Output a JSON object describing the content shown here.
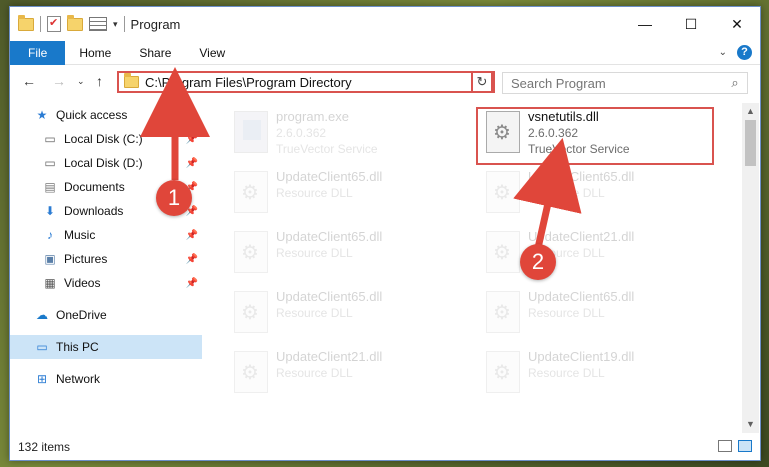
{
  "window": {
    "title": "Program",
    "controls": {
      "minimize": "—",
      "maximize": "☐",
      "close": "✕"
    }
  },
  "ribbon": {
    "tabs": [
      "File",
      "Home",
      "Share",
      "View"
    ],
    "expand_icon": "chevron-down",
    "help": "?"
  },
  "address": {
    "path": "C:\\Program Files\\Program Directory",
    "search_placeholder": "Search Program"
  },
  "sidebar": {
    "items": [
      {
        "label": "Quick access",
        "icon": "star-icon",
        "pinned": false
      },
      {
        "label": "Local Disk (C:)",
        "icon": "drive-icon",
        "pinned": true
      },
      {
        "label": "Local Disk (D:)",
        "icon": "drive-icon",
        "pinned": true
      },
      {
        "label": "Documents",
        "icon": "documents-icon",
        "pinned": true
      },
      {
        "label": "Downloads",
        "icon": "downloads-icon",
        "pinned": true
      },
      {
        "label": "Music",
        "icon": "music-icon",
        "pinned": true
      },
      {
        "label": "Pictures",
        "icon": "pictures-icon",
        "pinned": true
      },
      {
        "label": "Videos",
        "icon": "videos-icon",
        "pinned": true
      },
      {
        "label": "OneDrive",
        "icon": "cloud-icon",
        "pinned": false
      },
      {
        "label": "This PC",
        "icon": "computer-icon",
        "pinned": false,
        "selected": true
      },
      {
        "label": "Network",
        "icon": "network-icon",
        "pinned": false
      }
    ]
  },
  "files": [
    {
      "name": "program.exe",
      "line2": "2.6.0.362",
      "line3": "TrueVector Service",
      "type": "exe",
      "faded": true
    },
    {
      "name": "vsnetutils.dll",
      "line2": "2.6.0.362",
      "line3": "TrueVector Service",
      "type": "dll",
      "faded": false,
      "highlighted": true
    },
    {
      "name": "UpdateClient65.dll",
      "line2": "Resource DLL",
      "type": "dll",
      "faded": true
    },
    {
      "name": "UpdateClient65.dll",
      "line2": "Resource DLL",
      "type": "dll",
      "faded": true
    },
    {
      "name": "UpdateClient65.dll",
      "line2": "Resource DLL",
      "type": "dll",
      "faded": true
    },
    {
      "name": "UpdateClient21.dll",
      "line2": "Resource DLL",
      "type": "dll",
      "faded": true
    },
    {
      "name": "UpdateClient65.dll",
      "line2": "Resource DLL",
      "type": "dll",
      "faded": true
    },
    {
      "name": "UpdateClient65.dll",
      "line2": "Resource DLL",
      "type": "dll",
      "faded": true
    },
    {
      "name": "UpdateClient21.dll",
      "line2": "Resource DLL",
      "type": "dll",
      "faded": true
    },
    {
      "name": "UpdateClient19.dll",
      "line2": "Resource DLL",
      "type": "dll",
      "faded": true
    }
  ],
  "status": {
    "item_count": "132 items"
  },
  "annotations": {
    "step1": "1",
    "step2": "2",
    "color": "#e0463a"
  }
}
